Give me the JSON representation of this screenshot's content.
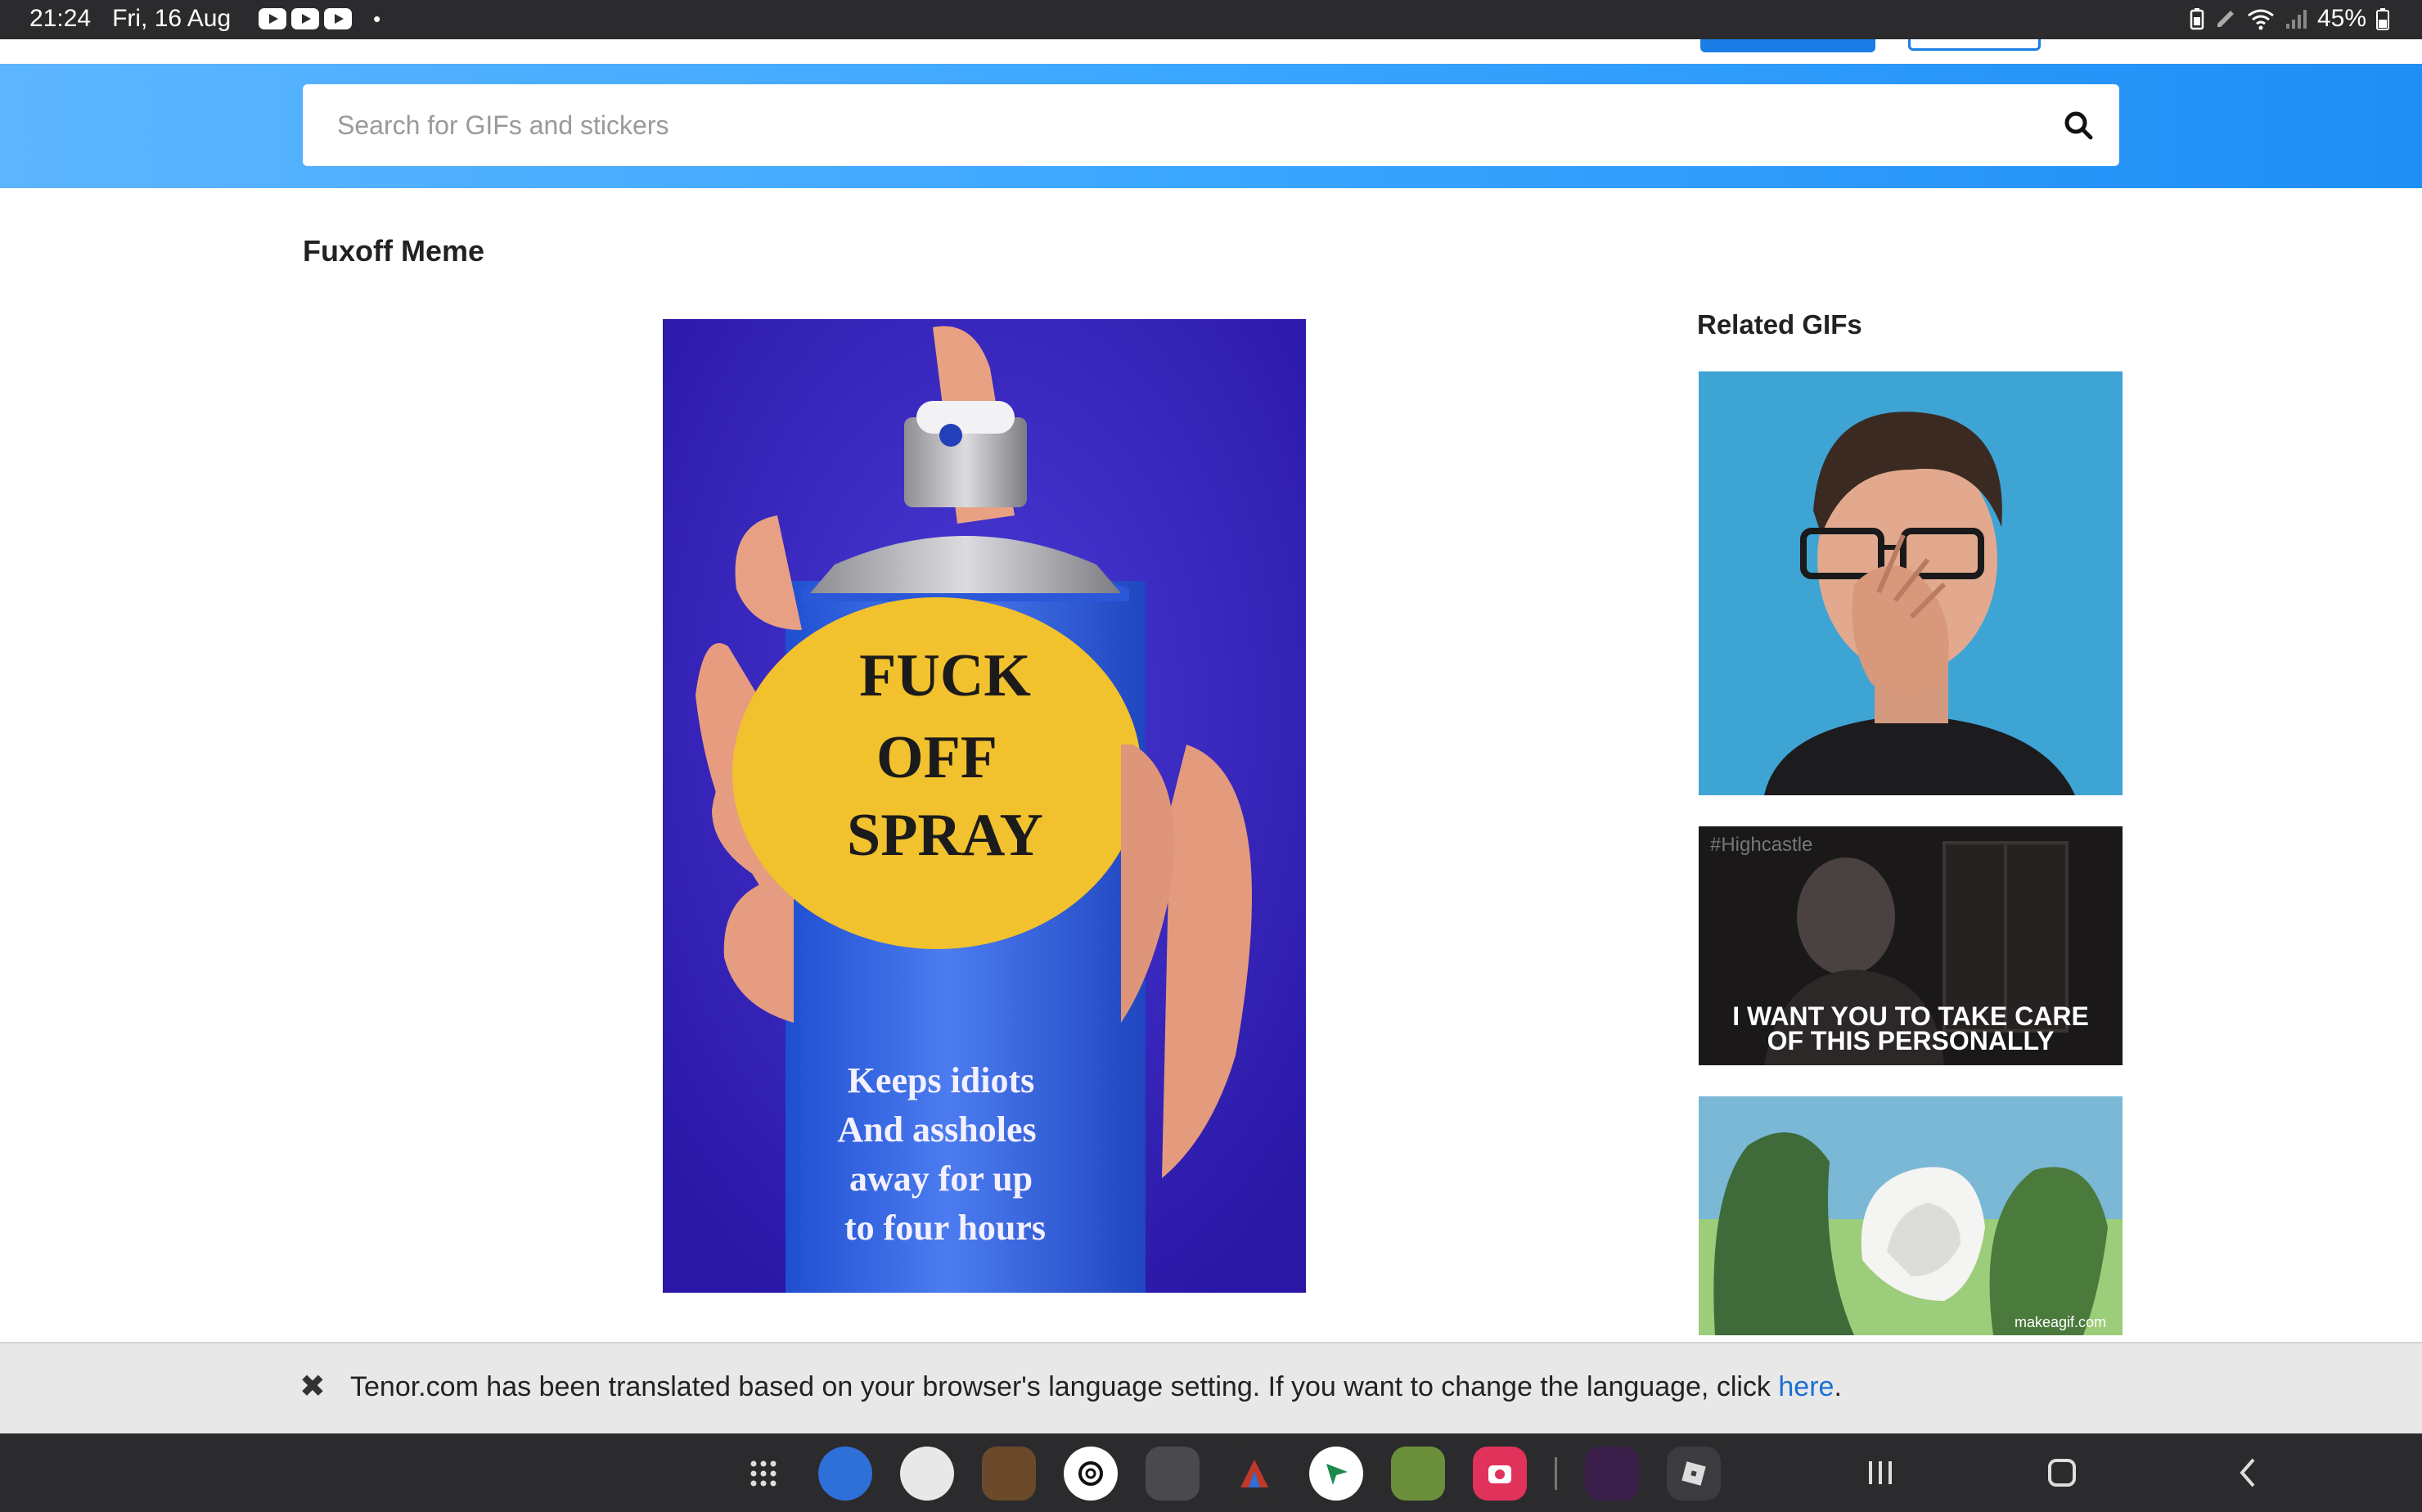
{
  "status_bar": {
    "time": "21:24",
    "date": "Fri, 16 Aug",
    "notification_icons": [
      "youtube-icon",
      "youtube-icon",
      "youtube-icon"
    ],
    "dot": "•",
    "battery_text": "45%",
    "right_icons": [
      "battery-saver-icon",
      "pen-icon",
      "wifi-icon",
      "signal-icon",
      "battery-icon"
    ]
  },
  "search": {
    "placeholder": "Search for GIFs and stickers"
  },
  "page": {
    "title": "Fuxoff Meme"
  },
  "main_gif": {
    "line1": "FUCK",
    "line2": "OFF",
    "line3": "SPRAY",
    "caption1": "Keeps idiots",
    "caption2": "And assholes",
    "caption3": "away for up",
    "caption4": "to four hours"
  },
  "related": {
    "title": "Related GIFs",
    "items": [
      {
        "caption": ""
      },
      {
        "watermark": "#Highcastle",
        "caption_line1": "I WANT YOU TO TAKE CARE",
        "caption_line2": "OF THIS PERSONALLY"
      },
      {
        "watermark": "makeagif.com"
      }
    ]
  },
  "translation_banner": {
    "close": "✖",
    "text": "Tenor.com has been translated based on your browser's language setting. If you want to change the language, click ",
    "link": "here",
    "suffix": "."
  },
  "nav_bar": {
    "apps": [
      "app-drawer-icon",
      "app-icon-1",
      "app-icon-2",
      "app-icon-3",
      "chatgpt-icon",
      "app-icon-5",
      "app-icon-6",
      "app-icon-7",
      "minecraft-icon",
      "camera-app-icon",
      "game-app-icon",
      "roblox-icon"
    ],
    "buttons": [
      "recents-button",
      "home-button",
      "back-button"
    ]
  },
  "colors": {
    "brand_blue": "#1a7ee6",
    "band_start": "#5db5ff",
    "band_end": "#1f8ef5",
    "link": "#1a6fd6",
    "system_bar": "#2b2b2d"
  }
}
